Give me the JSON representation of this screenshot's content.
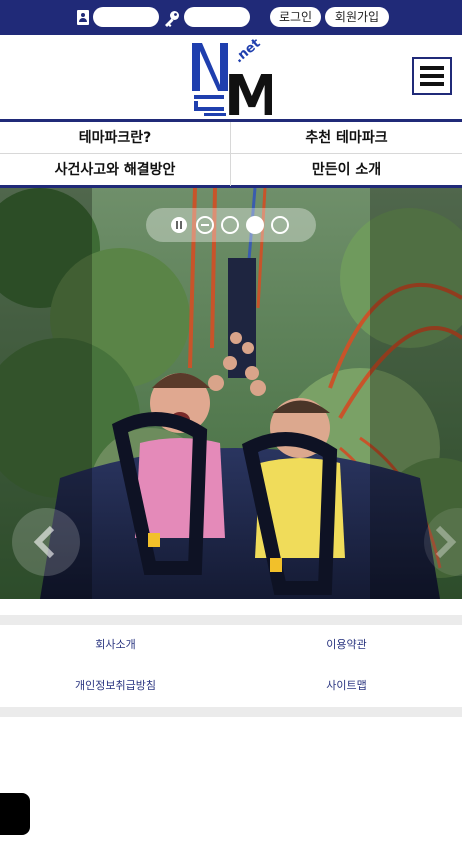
{
  "topbar": {
    "id_placeholder": "",
    "pw_placeholder": "",
    "login_label": "로그인",
    "join_label": "회원가입",
    "bg_color": "#202a78",
    "id_icon": "id-card-icon",
    "key_icon": "key-icon"
  },
  "header": {
    "logo_text": "Me",
    "logo_suffix": ".net",
    "menu_icon": "hamburger-icon"
  },
  "nav": {
    "items": [
      {
        "label": "테마파크란?"
      },
      {
        "label": "추천 테마파크"
      },
      {
        "label": "사건사고와 해결방안"
      },
      {
        "label": "만든이 소개"
      }
    ]
  },
  "slider": {
    "slide_count": 4,
    "active_slide": 3,
    "controls": [
      "pause-icon",
      "chevron-left-icon",
      "chevron-right-icon"
    ]
  },
  "footer": {
    "links": [
      {
        "label": "회사소개"
      },
      {
        "label": "이용약관"
      },
      {
        "label": "개인정보취급방침"
      },
      {
        "label": "사이트맵"
      }
    ]
  }
}
